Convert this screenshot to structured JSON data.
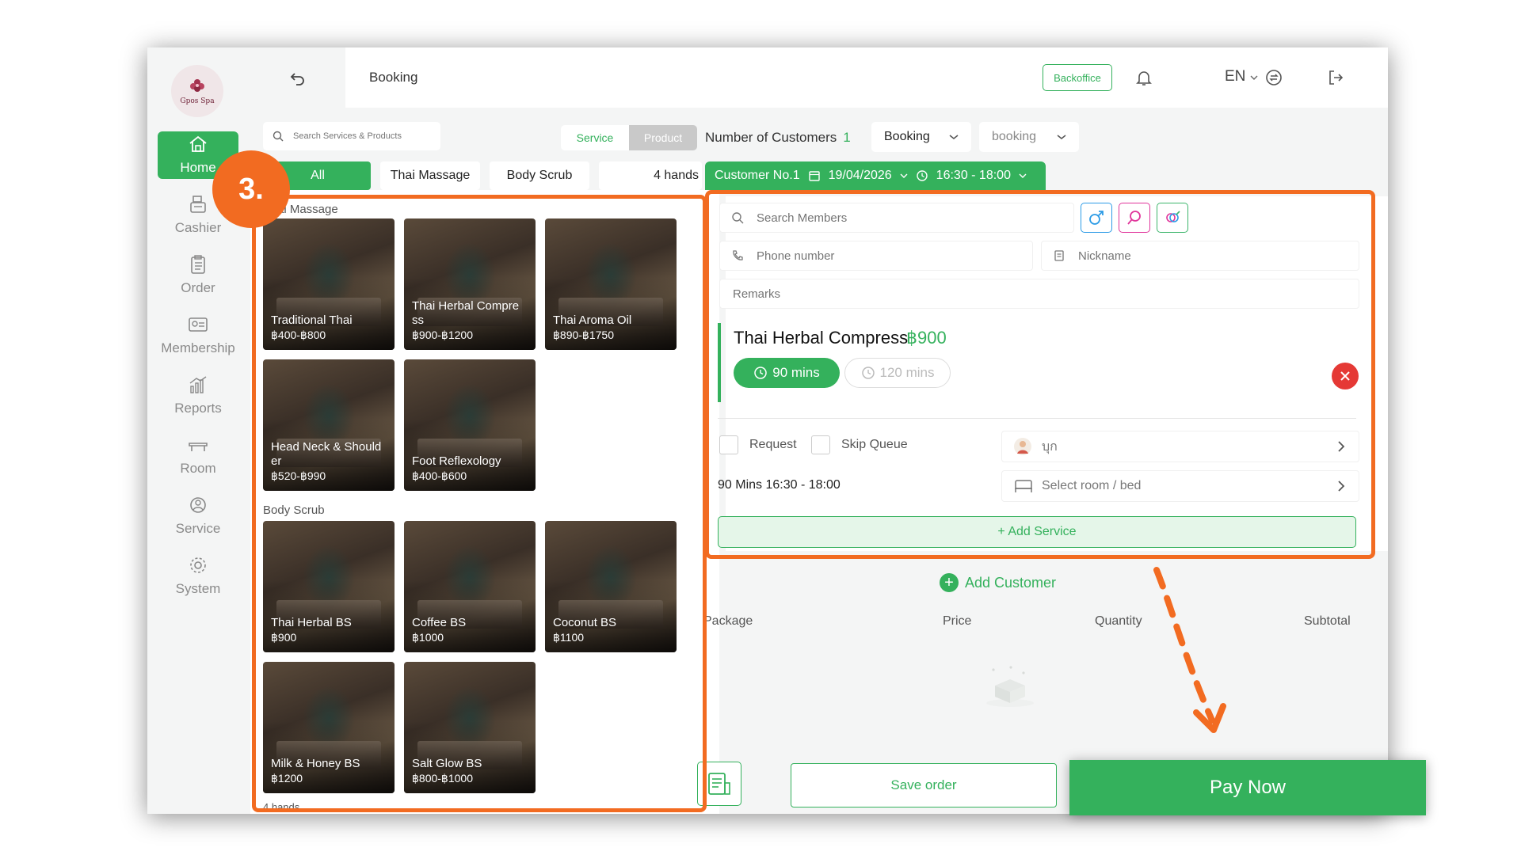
{
  "sidebar": {
    "logo_text": "Gpos Spa",
    "items": [
      {
        "label": "Home"
      },
      {
        "label": "Cashier"
      },
      {
        "label": "Order"
      },
      {
        "label": "Membership"
      },
      {
        "label": "Reports"
      },
      {
        "label": "Room"
      },
      {
        "label": "Service"
      },
      {
        "label": "System"
      }
    ]
  },
  "header": {
    "title": "Booking",
    "backoffice": "Backoffice",
    "language": "EN"
  },
  "search": {
    "placeholder": "Search Services & Products"
  },
  "tabs": {
    "service": "Service",
    "product": "Product"
  },
  "customers": {
    "label": "Number of Customers",
    "count": "1"
  },
  "dropdowns": {
    "booking_type": "Booking",
    "booking_status": "booking"
  },
  "categories": [
    "All",
    "Thai Massage",
    "Body Scrub",
    "4 hands"
  ],
  "sections": {
    "thai_massage": "ai Massage",
    "body_scrub": "Body Scrub",
    "four_hands": "4 hands"
  },
  "cards": [
    {
      "name": "Traditional Thai",
      "price": "฿400-฿800"
    },
    {
      "name": "Thai Herbal Compre ss",
      "price": "฿900-฿1200"
    },
    {
      "name": "Thai Aroma Oil",
      "price": "฿890-฿1750"
    },
    {
      "name": "Head Neck & Should er",
      "price": "฿520-฿990"
    },
    {
      "name": "Foot Reflexology",
      "price": "฿400-฿600"
    },
    {
      "name": "Thai Herbal BS",
      "price": "฿900"
    },
    {
      "name": "Coffee BS",
      "price": "฿1000"
    },
    {
      "name": "Coconut BS",
      "price": "฿1100"
    },
    {
      "name": "Milk & Honey BS",
      "price": "฿1200"
    },
    {
      "name": "Salt Glow BS",
      "price": "฿800-฿1000"
    }
  ],
  "customer_tab": {
    "label": "Customer No.1",
    "date": "19/04/2026",
    "time": "16:30 - 18:00"
  },
  "form": {
    "search_members": "Search Members",
    "phone": "Phone number",
    "nickname": "Nickname",
    "remarks": "Remarks"
  },
  "selected_service": {
    "name": "Thai Herbal Compress",
    "price": "฿900",
    "durations": [
      "90 mins",
      "120 mins"
    ],
    "request": "Request",
    "skip_queue": "Skip Queue",
    "therapist": "บุก",
    "room": "Select room / bed",
    "time_info": "90 Mins  16:30 - 18:00"
  },
  "add_service": "+ Add Service",
  "add_customer": "Add Customer",
  "columns": [
    "Package",
    "Price",
    "Quantity",
    "Subtotal"
  ],
  "actions": {
    "save": "Save order",
    "pay": "Pay Now"
  },
  "annotation": {
    "step": "3."
  },
  "colors": {
    "primary": "#34b15c",
    "accent_orange": "#f26b21",
    "danger": "#e53935"
  }
}
